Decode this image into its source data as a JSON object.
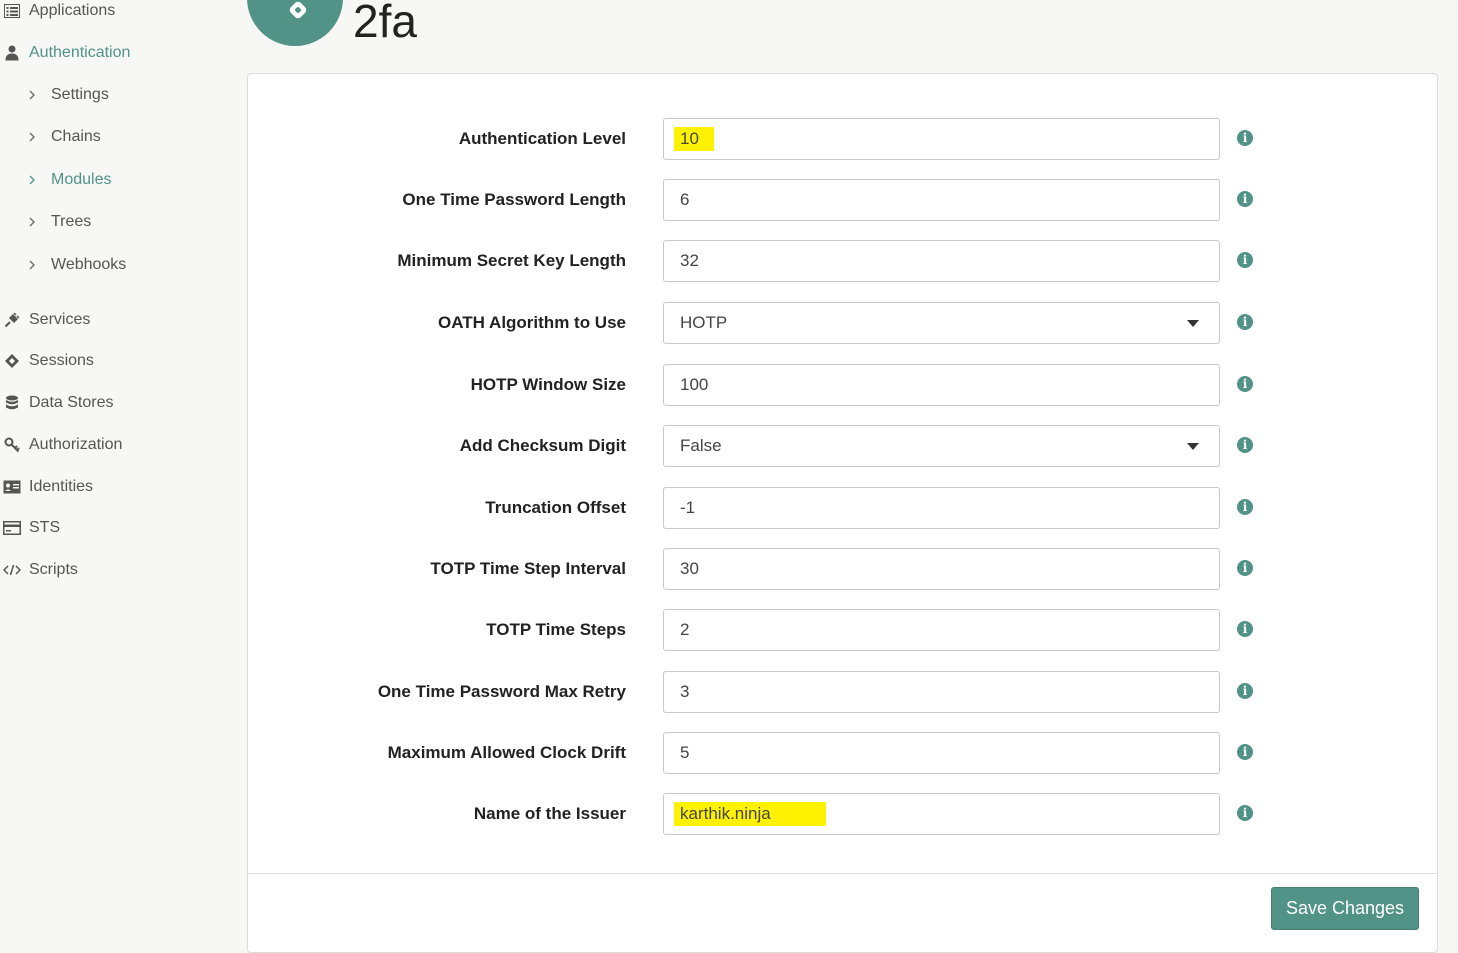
{
  "sidebar": {
    "items": [
      {
        "label": "Applications",
        "icon": "applications-icon"
      },
      {
        "label": "Authentication",
        "icon": "user-icon",
        "active": true
      },
      {
        "label": "Services",
        "icon": "plug-icon"
      },
      {
        "label": "Sessions",
        "icon": "ticket-icon"
      },
      {
        "label": "Data Stores",
        "icon": "database-icon"
      },
      {
        "label": "Authorization",
        "icon": "key-icon"
      },
      {
        "label": "Identities",
        "icon": "id-card-icon"
      },
      {
        "label": "STS",
        "icon": "credit-card-icon"
      },
      {
        "label": "Scripts",
        "icon": "code-icon"
      }
    ],
    "sub_items": [
      {
        "label": "Settings"
      },
      {
        "label": "Chains"
      },
      {
        "label": "Modules",
        "active": true
      },
      {
        "label": "Trees"
      },
      {
        "label": "Webhooks"
      }
    ]
  },
  "header": {
    "title": "2fa",
    "logo_icon": "link-icon"
  },
  "form": {
    "fields": [
      {
        "label": "Authentication Level",
        "value": "10",
        "type": "text",
        "highlighted": true
      },
      {
        "label": "One Time Password Length",
        "value": "6",
        "type": "text"
      },
      {
        "label": "Minimum Secret Key Length",
        "value": "32",
        "type": "text"
      },
      {
        "label": "OATH Algorithm to Use",
        "value": "HOTP",
        "type": "select"
      },
      {
        "label": "HOTP Window Size",
        "value": "100",
        "type": "text"
      },
      {
        "label": "Add Checksum Digit",
        "value": "False",
        "type": "select"
      },
      {
        "label": "Truncation Offset",
        "value": "-1",
        "type": "text"
      },
      {
        "label": "TOTP Time Step Interval",
        "value": "30",
        "type": "text"
      },
      {
        "label": "TOTP Time Steps",
        "value": "2",
        "type": "text"
      },
      {
        "label": "One Time Password Max Retry",
        "value": "3",
        "type": "text"
      },
      {
        "label": "Maximum Allowed Clock Drift",
        "value": "5",
        "type": "text"
      },
      {
        "label": "Name of the Issuer",
        "value": "karthik.ninja",
        "type": "text",
        "highlighted": true
      }
    ],
    "info_icon": "info-icon",
    "save_label": "Save Changes"
  },
  "colors": {
    "accent": "#519387",
    "highlight": "#fff200"
  }
}
